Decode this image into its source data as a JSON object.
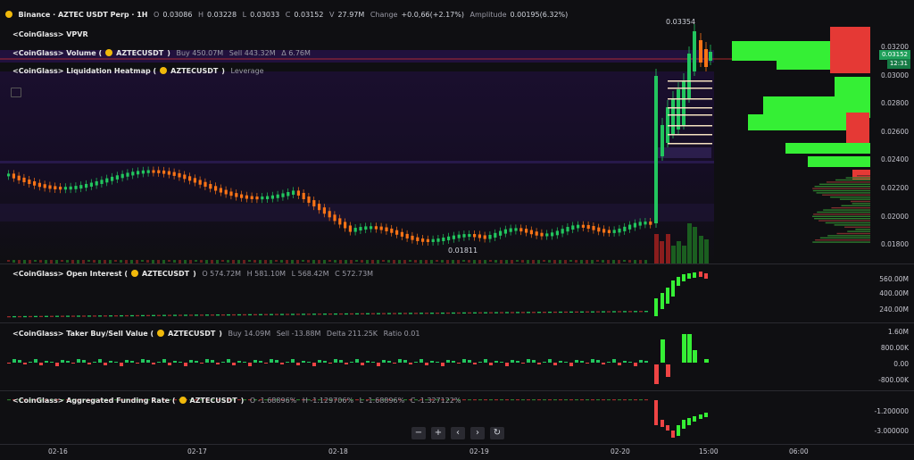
{
  "header": {
    "exchange": "Binance · AZTEC USDT Perp · 1H",
    "o_label": "O",
    "o": "0.03086",
    "h_label": "H",
    "h": "0.03228",
    "l_label": "L",
    "l": "0.03033",
    "c_label": "C",
    "c": "0.03152",
    "v_label": "V",
    "v": "27.97M",
    "change_label": "Change",
    "change": "+0.0,66(+2.17%)",
    "amp_label": "Amplitude",
    "amp": "0.00195(6.32%)"
  },
  "indicators": {
    "vpvr": "<CoinGlass> VPVR",
    "volume": "<CoinGlass> Volume (",
    "volume_sym": "AZTECUSDT",
    "volume_buy": "Buy 450.07M",
    "volume_sell": "Sell 443.32M",
    "volume_delta": "Δ 6.76M",
    "heatmap": "<CoinGlass> Liquidation Heatmap (",
    "heatmap_sym": "AZTECUSDT",
    "heatmap_extra": "Leverage",
    "oi": "<CoinGlass> Open Interest (",
    "oi_sym": "AZTECUSDT",
    "oi_o": "O 574.72M",
    "oi_h": "H 581.10M",
    "oi_l": "L 568.42M",
    "oi_c": "C 572.73M",
    "taker": "<CoinGlass> Taker Buy/Sell Value (",
    "taker_sym": "AZTECUSDT",
    "taker_buy": "Buy 14.09M",
    "taker_sell": "Sell -13.88M",
    "taker_delta": "Delta 211.25K",
    "taker_ratio": "Ratio 0.01",
    "funding": "<CoinGlass> Aggregated Funding Rate (",
    "funding_sym": "AZTECUSDT",
    "funding_o": "O -1.68896%",
    "funding_h": "H -1.129706%",
    "funding_l": "L -1.68896%",
    "funding_c": "C -1.327122%",
    "close_paren": ")"
  },
  "price_axis": {
    "ticks": [
      "0.03200",
      "0.03000",
      "0.02800",
      "0.02600",
      "0.02400",
      "0.02200",
      "0.02000",
      "0.01800"
    ],
    "last_price": "0.03152",
    "countdown": "12:31",
    "high_marker": "0.03354",
    "low_marker": "0.01811"
  },
  "oi_axis": [
    "560.00M",
    "400.00M",
    "240.00M"
  ],
  "taker_axis": [
    "1.60M",
    "800.00K",
    "0.00",
    "-800.00K"
  ],
  "funding_axis": [
    "-1.200000",
    "-3.000000"
  ],
  "time_axis": [
    "02-16",
    "02-17",
    "02-18",
    "02-19",
    "02-20",
    "15:00",
    "06:00"
  ],
  "nav": {
    "zoom_out": "−",
    "zoom_in": "+",
    "prev": "‹",
    "next": "›",
    "reset": "↻"
  },
  "colors": {
    "up": "#22c55e",
    "down": "#ef4444",
    "orange": "#f97316",
    "green_bright": "#35ef35",
    "red_block": "#e53935"
  }
}
